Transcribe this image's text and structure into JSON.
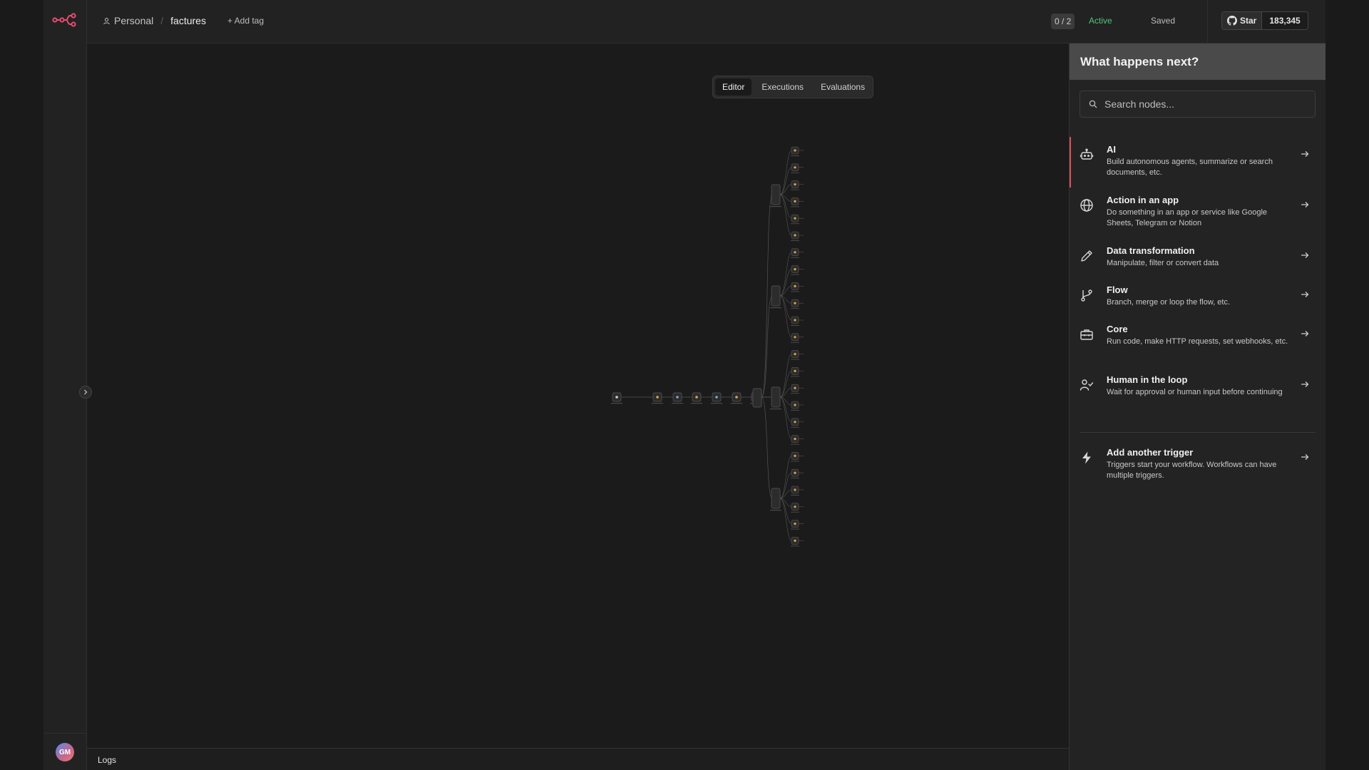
{
  "breadcrumb": {
    "project": "Personal",
    "separator": "/",
    "workflow_name": "factures",
    "add_tag": "+ Add tag"
  },
  "status": {
    "counter": "0 / 2",
    "active": "Active",
    "saved": "Saved"
  },
  "github": {
    "star_label": "Star",
    "star_count": "183,345"
  },
  "view_tabs": [
    {
      "label": "Editor",
      "active": true
    },
    {
      "label": "Executions",
      "active": false
    },
    {
      "label": "Evaluations",
      "active": false
    }
  ],
  "sidebar": {
    "avatar_initials": "GM"
  },
  "logs": {
    "label": "Logs"
  },
  "panel": {
    "title": "What happens next?",
    "search_placeholder": "Search nodes...",
    "categories": [
      {
        "title": "AI",
        "desc": "Build autonomous agents, summarize or search documents, etc.",
        "icon": "robot-icon"
      },
      {
        "title": "Action in an app",
        "desc": "Do something in an app or service like Google Sheets, Telegram or Notion",
        "icon": "globe-icon"
      },
      {
        "title": "Data transformation",
        "desc": "Manipulate, filter or convert data",
        "icon": "pencil-icon"
      },
      {
        "title": "Flow",
        "desc": "Branch, merge or loop the flow, etc.",
        "icon": "branch-icon"
      },
      {
        "title": "Core",
        "desc": "Run code, make HTTP requests, set webhooks, etc.",
        "icon": "toolbox-icon"
      },
      {
        "title": "Human in the loop",
        "desc": "Wait for approval or human input before continuing",
        "icon": "user-check-icon"
      }
    ],
    "trigger": {
      "title": "Add another trigger",
      "desc": "Triggers start your workflow. Workflows can have multiple triggers.",
      "icon": "bolt-icon"
    }
  },
  "colors": {
    "accent": "#e04e5a",
    "active_green": "#4fc47c",
    "canvas_bg": "#1b1b1b",
    "panel_header_bg": "#4a4a4a"
  }
}
